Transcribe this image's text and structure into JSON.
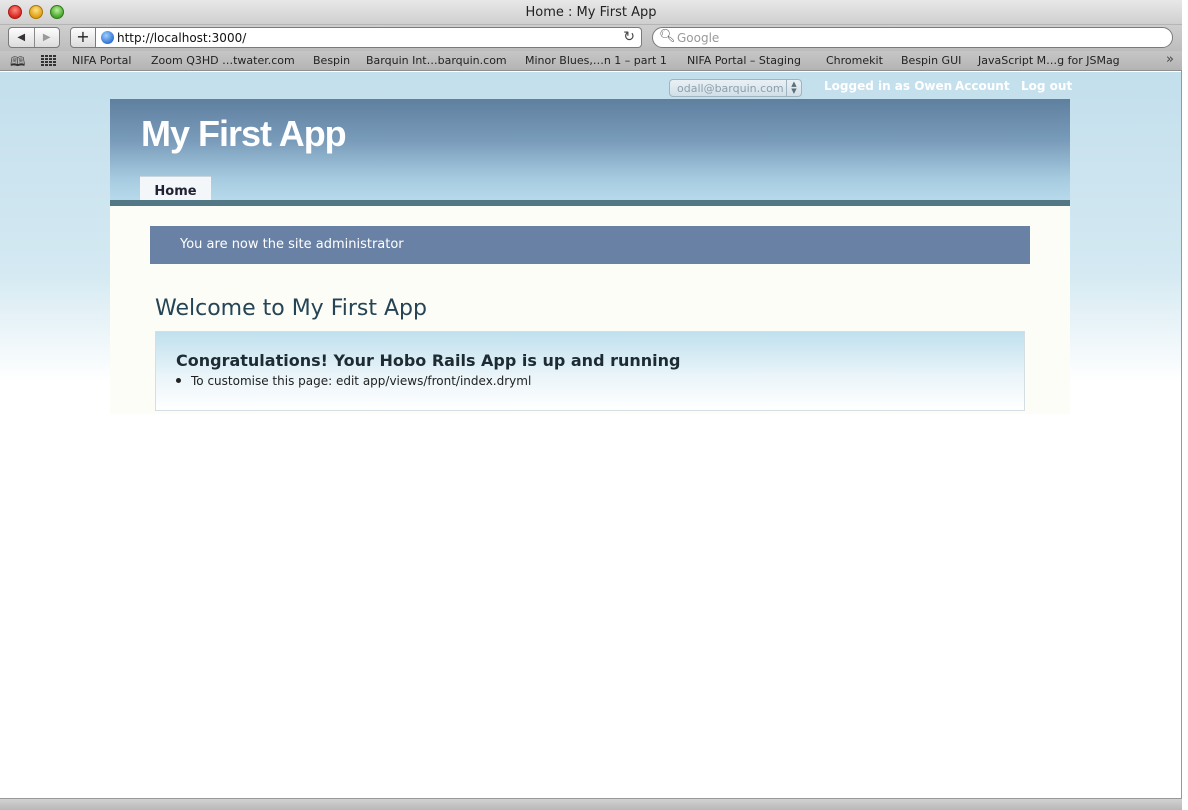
{
  "window": {
    "title": "Home : My First App"
  },
  "toolbar": {
    "back_glyph": "◀",
    "forward_glyph": "▶",
    "add_glyph": "+",
    "url": "http://localhost:3000/",
    "reload_glyph": "↻",
    "search_placeholder": "Google"
  },
  "bookmarks": [
    "NIFA Portal",
    "Zoom Q3HD …twater.com",
    "Bespin",
    "Barquin Int…barquin.com",
    "Minor Blues,…n 1 – part 1",
    "NIFA Portal –  Staging",
    "Chromekit",
    "Bespin GUI",
    "JavaScript M…g for JSMag"
  ],
  "account": {
    "select_value": "odall@barquin.com",
    "logged_in": "Logged in as Owen",
    "account_link": "Account",
    "logout_link": "Log out"
  },
  "app": {
    "title": "My First App",
    "tabs": [
      {
        "label": "Home"
      }
    ],
    "flash": "You are now the site administrator",
    "welcome": "Welcome to My First App",
    "card": {
      "heading": "Congratulations! Your Hobo Rails App is up and running",
      "items": [
        "To customise this page: edit app/views/front/index.dryml"
      ]
    }
  },
  "colors": {
    "header_dark": "#5f7f9f",
    "flash_bg": "#6981a4",
    "rule": "#527886"
  }
}
